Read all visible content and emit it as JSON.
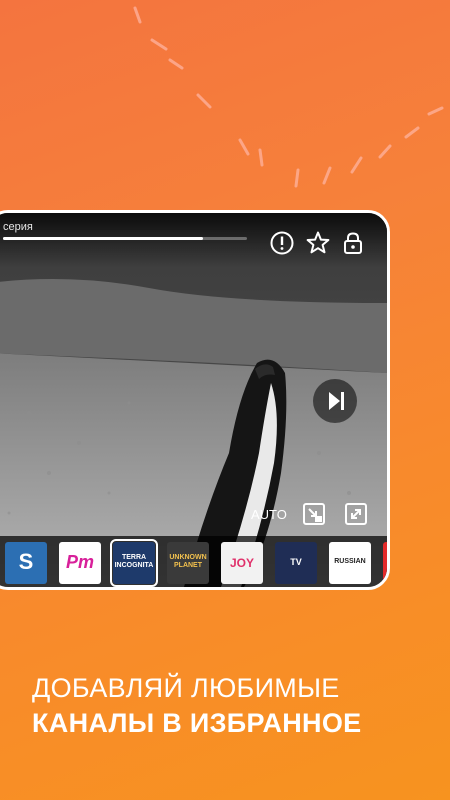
{
  "player": {
    "episode_title": "серия",
    "progress": 0.82,
    "quality_label": "AUTO",
    "top_icons": [
      "alert-icon",
      "star-icon",
      "lock-icon"
    ],
    "bottom_icons": [
      "picture-in-picture-icon",
      "fullscreen-icon"
    ]
  },
  "channels": [
    {
      "name": "S",
      "icon": "channel-s-logo"
    },
    {
      "name": "Pm",
      "icon": "channel-pm-logo"
    },
    {
      "name": "TERRA INCOGNITA",
      "icon": "channel-terra-incognita-logo",
      "active": true
    },
    {
      "name": "UNKNOWN PLANET",
      "icon": "channel-unknown-planet-logo"
    },
    {
      "name": "JOY",
      "icon": "channel-joy-logo"
    },
    {
      "name": "TV",
      "icon": "channel-tv-logo"
    },
    {
      "name": "RUSSIAN",
      "icon": "channel-russian-logo"
    },
    {
      "name": "",
      "icon": "channel-red-logo"
    }
  ],
  "tagline": {
    "line1": "ДОБАВЛЯЙ ЛЮБИМЫЕ",
    "line2": "КАНАЛЫ  В ИЗБРАННОЕ"
  },
  "colors": {
    "background_start": "#f4743f",
    "background_end": "#f7931f",
    "accent": "#ffffff"
  }
}
